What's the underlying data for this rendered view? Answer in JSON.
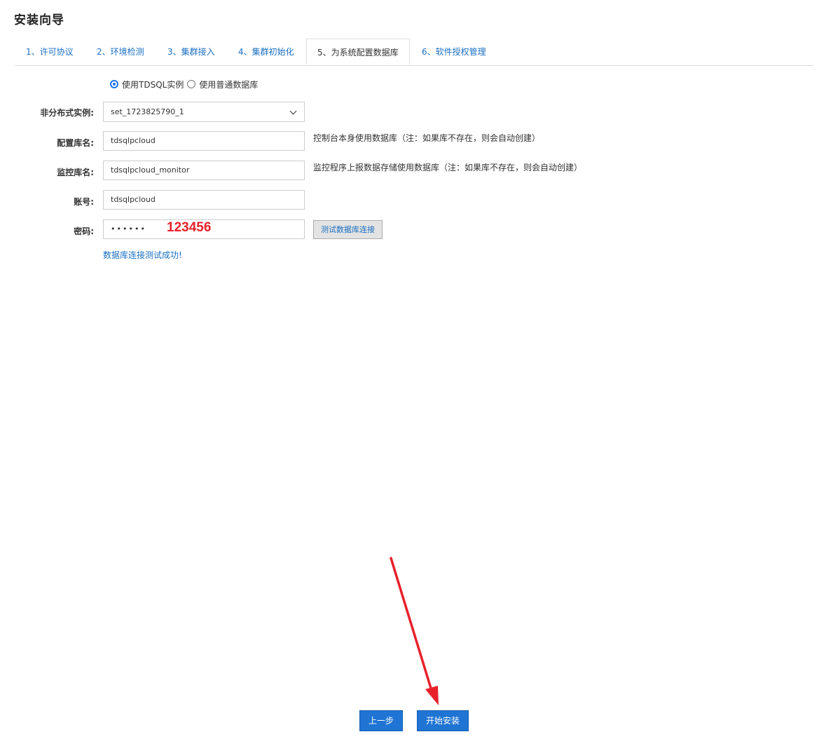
{
  "page": {
    "title": "安装向导"
  },
  "tabs": [
    {
      "label": "1、许可协议",
      "active": false
    },
    {
      "label": "2、环境检测",
      "active": false
    },
    {
      "label": "3、集群接入",
      "active": false
    },
    {
      "label": "4、集群初始化",
      "active": false
    },
    {
      "label": "5、为系统配置数据库",
      "active": true
    },
    {
      "label": "6、软件授权管理",
      "active": false
    }
  ],
  "db_type": {
    "options": [
      {
        "label": "使用TDSQL实例",
        "checked": true
      },
      {
        "label": "使用普通数据库",
        "checked": false
      }
    ]
  },
  "form": {
    "instance": {
      "label": "非分布式实例:",
      "value": "set_1723825790_1"
    },
    "config_db": {
      "label": "配置库名:",
      "value": "tdsqlpcloud",
      "hint": "控制台本身使用数据库（注：如果库不存在，则会自动创建）"
    },
    "monitor_db": {
      "label": "监控库名:",
      "value": "tdsqlpcloud_monitor",
      "hint": "监控程序上报数据存储使用数据库（注：如果库不存在，则会自动创建）"
    },
    "account": {
      "label": "账号:",
      "value": "tdsqlpcloud"
    },
    "password": {
      "label": "密码:",
      "masked_value": "••••••",
      "annotation": "123456"
    }
  },
  "test_button_label": "测试数据库连接",
  "test_result": "数据库连接测试成功!",
  "footer": {
    "prev_label": "上一步",
    "install_label": "开始安装"
  },
  "colors": {
    "link_blue": "#1a6fc2",
    "primary_button": "#1f74d4",
    "annotation_red": "#e8202a"
  }
}
